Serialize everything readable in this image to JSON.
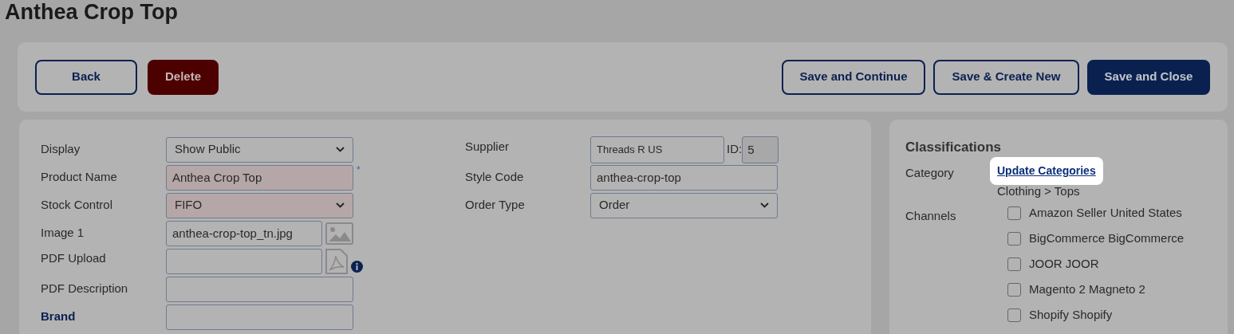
{
  "page_title": "Anthea Crop Top",
  "toolbar": {
    "left_buttons": [
      {
        "label": "Back",
        "kind": "outline"
      },
      {
        "label": "Delete",
        "kind": "danger"
      }
    ],
    "right_buttons": [
      {
        "label": "Save and Continue",
        "kind": "outline"
      },
      {
        "label": "Save & Create New",
        "kind": "outline"
      },
      {
        "label": "Save and Close",
        "kind": "primary"
      }
    ]
  },
  "form": {
    "left_fields": [
      {
        "label": "Display",
        "label_bold": false,
        "kind": "select",
        "value": "Show Public",
        "highlighted": false
      },
      {
        "label": "Product Name",
        "label_bold": false,
        "kind": "text",
        "value": "Anthea Crop Top",
        "highlighted": true,
        "required_mark": "*"
      },
      {
        "label": "Stock Control",
        "label_bold": false,
        "kind": "select",
        "value": "FIFO",
        "highlighted": true
      },
      {
        "label": "Image 1",
        "label_bold": false,
        "kind": "image",
        "value": "anthea-crop-top_tn.jpg",
        "highlighted": false
      },
      {
        "label": "PDF Upload",
        "label_bold": false,
        "kind": "pdf",
        "highlighted": false
      },
      {
        "label": "PDF Description",
        "label_bold": false,
        "kind": "text",
        "highlighted": false
      },
      {
        "label": "Brand",
        "label_bold": true,
        "kind": "text",
        "highlighted": false
      }
    ],
    "right_fields": [
      {
        "label": "Supplier",
        "kind": "supplier",
        "value": "Threads R US",
        "id_label": "ID:",
        "id_value": "5"
      },
      {
        "label": "Style Code",
        "kind": "text",
        "value": "anthea-crop-top"
      },
      {
        "label": "Order Type",
        "kind": "select",
        "value": "Order"
      }
    ]
  },
  "classifications": {
    "title": "Classifications",
    "category_label": "Category",
    "update_link": {
      "label": "Update Categories",
      "spotlight": true
    },
    "category_path": "Clothing > Tops",
    "channels_label": "Channels",
    "channels": [
      {
        "label": "Amazon Seller United States",
        "checked": false
      },
      {
        "label": "BigCommerce BigCommerce",
        "checked": false
      },
      {
        "label": "JOOR JOOR",
        "checked": false
      },
      {
        "label": "Magento 2 Magneto 2",
        "checked": false
      },
      {
        "label": "Shopify Shopify",
        "checked": false
      }
    ]
  }
}
